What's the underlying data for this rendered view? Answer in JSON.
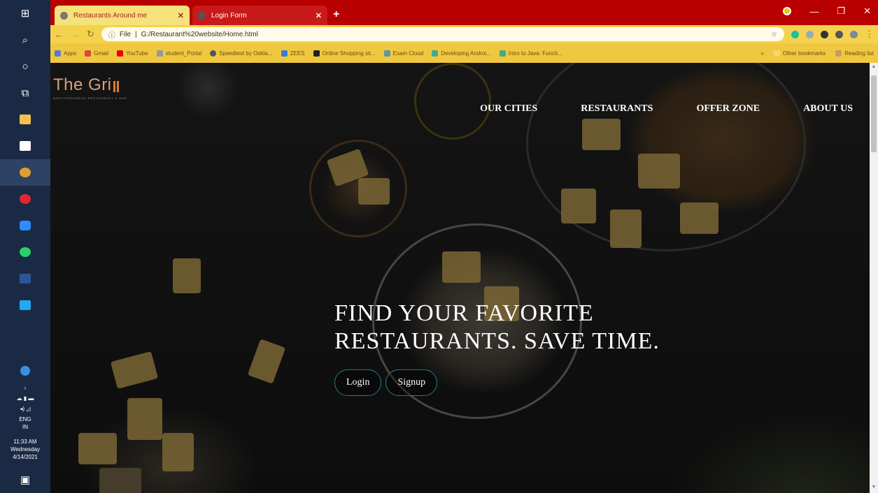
{
  "taskbar": {
    "clock_time": "11:33 AM",
    "clock_day": "Wednesday",
    "clock_date": "4/14/2021",
    "lang_line1": "ENG",
    "lang_line2": "IN",
    "colors": {
      "bg": "#1b2a44"
    }
  },
  "browser": {
    "tabs": [
      {
        "title": "Restaurants Around me",
        "active": true
      },
      {
        "title": "Login Form",
        "active": false
      }
    ],
    "address": "G:/Restaurant%20website/Home.html",
    "scheme_label": "File",
    "bookmarks": [
      {
        "label": "Apps",
        "color": "#5a7ad0"
      },
      {
        "label": "Gmail",
        "color": "#d44"
      },
      {
        "label": "YouTube",
        "color": "#e00"
      },
      {
        "label": "student_Portal",
        "color": "#999"
      },
      {
        "label": "Speedtest by Ookla...",
        "color": "#555"
      },
      {
        "label": "ZEES",
        "color": "#3a7bd5"
      },
      {
        "label": "Online Shopping sit...",
        "color": "#222"
      },
      {
        "label": "Exam Cloud",
        "color": "#59a"
      },
      {
        "label": "Developing Androi...",
        "color": "#4a8"
      },
      {
        "label": "Intro to Java: Functi...",
        "color": "#4a8"
      }
    ],
    "other_bookmarks": "Other bookmarks",
    "reading_list": "Reading list",
    "colors": {
      "tabbar": "#b90000",
      "toolbar": "#f4d24e",
      "bookmarks": "#f0c840"
    }
  },
  "site": {
    "logo_text": "The Gri",
    "logo_tagline": "MEDITERRANEAN RESTAURANT & BAR",
    "nav": [
      "OUR CITIES",
      "RESTAURANTS",
      "OFFER ZONE",
      "ABOUT US"
    ],
    "hero_line1": "FIND YOUR FAVORITE",
    "hero_line2": "RESTAURANTS. SAVE TIME.",
    "login_label": "Login",
    "signup_label": "Signup",
    "colors": {
      "logo": "#d5a17a",
      "button_border": "#1f7f85"
    }
  }
}
